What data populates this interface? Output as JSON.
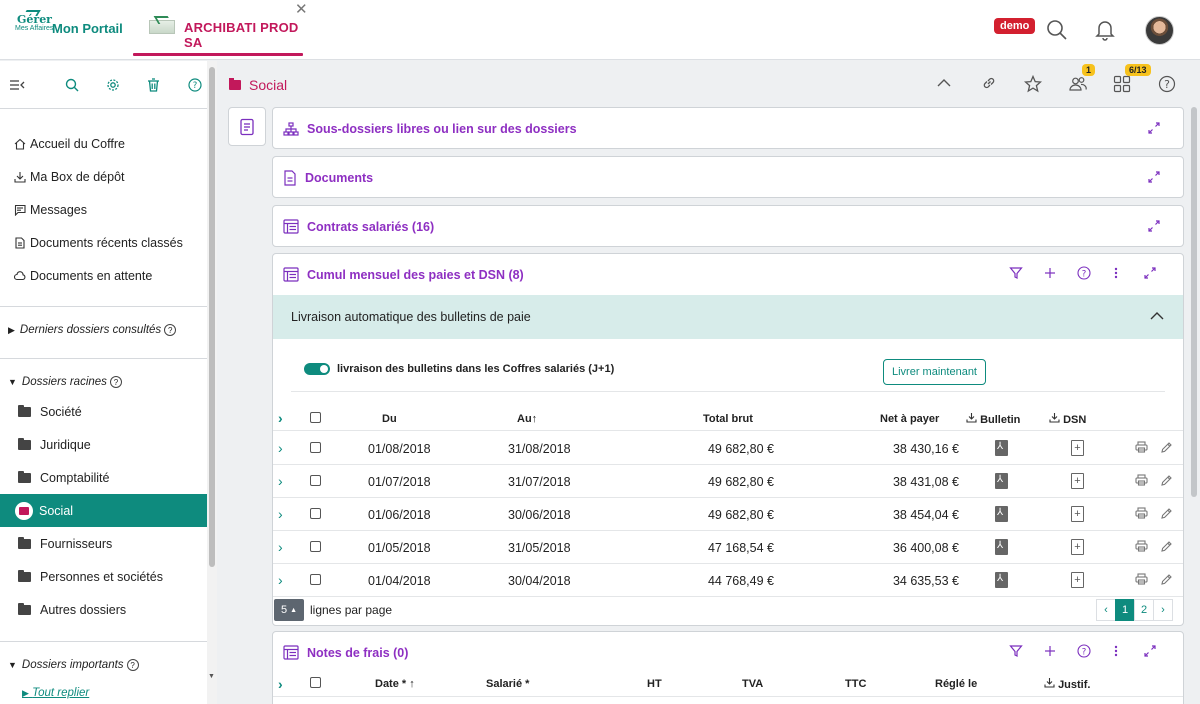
{
  "topbar": {
    "brand_logo_text": "Gérer",
    "brand_logo_sub": "Mes Affaires",
    "brand_name": "Mon Portail",
    "tab_label": "ARCHIBATI PROD SA",
    "close_symbol": "✕",
    "demo_label": "demo"
  },
  "sidebar": {
    "nav": [
      {
        "label": "Accueil du Coffre",
        "icon": "home-icon"
      },
      {
        "label": "Ma Box de dépôt",
        "icon": "download-icon"
      },
      {
        "label": "Messages",
        "icon": "message-icon"
      },
      {
        "label": "Documents récents classés",
        "icon": "document-icon"
      },
      {
        "label": "Documents en attente",
        "icon": "cloud-icon"
      }
    ],
    "recent_section": "Derniers dossiers consultés",
    "roots_section": "Dossiers racines",
    "folders": [
      "Société",
      "Juridique",
      "Comptabilité",
      "Social",
      "Fournisseurs",
      "Personnes et sociétés",
      "Autres dossiers"
    ],
    "important_section": "Dossiers importants",
    "tout_replier": "Tout replier",
    "help_symbol": "?"
  },
  "main": {
    "title": "Social",
    "badge_people": "1",
    "badge_tasks": "6/13",
    "panels": [
      {
        "title": "Sous-dossiers libres ou lien sur des dossiers"
      },
      {
        "title": "Documents"
      },
      {
        "title": "Contrats salariés (16)"
      },
      {
        "title": "Cumul mensuel des paies et DSN (8)"
      },
      {
        "title": "Notes de frais (0)"
      }
    ]
  },
  "payroll": {
    "banner": "Livraison automatique des bulletins de paie",
    "toggle_label": "livraison des bulletins dans les Coffres salariés (J+1)",
    "livrer_button": "Livrer maintenant",
    "columns": {
      "du": "Du",
      "au": "Au",
      "au_sort": "↑",
      "brut": "Total brut",
      "net": "Net à payer",
      "bulletin": "Bulletin",
      "dsn": "DSN"
    },
    "rows": [
      {
        "du": "01/08/2018",
        "au": "31/08/2018",
        "brut": "49 682,80 €",
        "net": "38 430,16 €"
      },
      {
        "du": "01/07/2018",
        "au": "31/07/2018",
        "brut": "49 682,80 €",
        "net": "38 431,08 €"
      },
      {
        "du": "01/06/2018",
        "au": "30/06/2018",
        "brut": "49 682,80 €",
        "net": "38 454,04 €"
      },
      {
        "du": "01/05/2018",
        "au": "31/05/2018",
        "brut": "47 168,54 €",
        "net": "36 400,08 €"
      },
      {
        "du": "01/04/2018",
        "au": "30/04/2018",
        "brut": "44 768,49 €",
        "net": "34 635,53 €"
      }
    ],
    "per_page_value": "5",
    "per_page_label": "lignes par page",
    "pager": {
      "prev": "‹",
      "pages": [
        "1",
        "2"
      ],
      "next": "›"
    }
  },
  "expenses": {
    "columns": {
      "date": "Date *",
      "date_sort": "↑",
      "salarie": "Salarié *",
      "ht": "HT",
      "tva": "TVA",
      "ttc": "TTC",
      "regle": "Réglé le",
      "justif": "Justif."
    }
  }
}
